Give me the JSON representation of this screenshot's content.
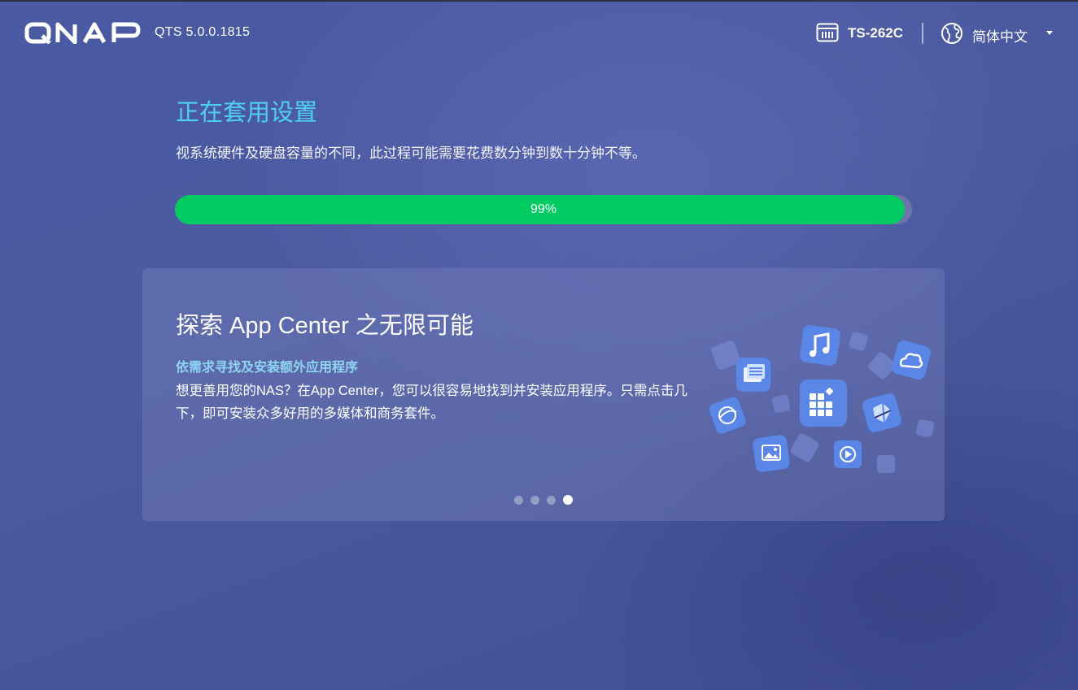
{
  "header": {
    "brand": "QNAP",
    "version": "QTS 5.0.0.1815",
    "device_name": "TS-262C",
    "language": "简体中文"
  },
  "progress": {
    "title": "正在套用设置",
    "subtitle": "视系统硬件及硬盘容量的不同，此过程可能需要花费数分钟到数十分钟不等。",
    "percent": 99,
    "label": "99%"
  },
  "card": {
    "title": "探索 App Center 之无限可能",
    "subtitle": "依需求寻找及安装额外应用程序",
    "body": "想更善用您的NAS？在App Center，您可以很容易地找到并安装应用程序。只需点击几下，即可安装众多好用的多媒体和商务套件。",
    "page_count": 4,
    "active_page": 4
  },
  "colors": {
    "title_accent": "#4fd0f0",
    "progress_fill": "#00cc62",
    "subtitle_accent": "#8fd5f2"
  }
}
